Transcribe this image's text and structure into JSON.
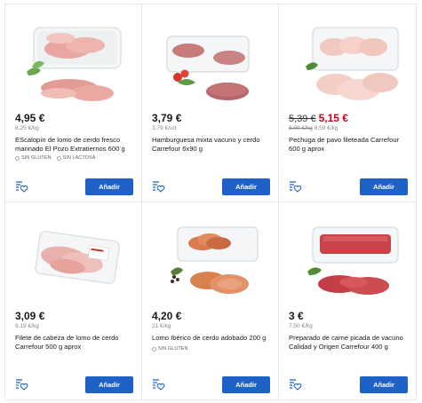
{
  "products": [
    {
      "price": "4,95 €",
      "old_price": "",
      "unit_price": "8,25 €/kg",
      "old_unit_price": "",
      "name": "EScalopín de lomo de cerdo fresco marinado El Pozo Extratiernos 600 g",
      "tags": [
        "SIN GLUTEN",
        "SIN LACTOSA"
      ],
      "image": "pork-loin-escalope-tray",
      "button": "Añadir"
    },
    {
      "price": "3,79 €",
      "old_price": "",
      "unit_price": "3,79 €/ud",
      "old_unit_price": "",
      "name": "Hamburguesa mixta vacuno y cerdo Carrefour 6x90 g",
      "tags": [],
      "image": "burger-patties-tray",
      "button": "Añadir"
    },
    {
      "price": "5,15 €",
      "old_price": "5,39 €",
      "unit_price": "8,59 €/kg",
      "old_unit_price": "8,99 €/kg",
      "name": "Pechuga de pavo fileteada Carrefour 600 g aprox",
      "tags": [],
      "image": "turkey-breast-fillets-tray",
      "button": "Añadir"
    },
    {
      "price": "3,09 €",
      "old_price": "",
      "unit_price": "6,19 €/kg",
      "old_unit_price": "",
      "name": "Filete de cabeza de lomo de cerdo Carrefour 500 g aprox",
      "tags": [],
      "image": "pork-neck-fillet-tray",
      "button": "Añadir"
    },
    {
      "price": "4,20 €",
      "old_price": "",
      "unit_price": "21 €/kg",
      "old_unit_price": "",
      "name": "Lomo Ibérico de cerdo adobado 200 g",
      "tags": [
        "SIN GLUTEN"
      ],
      "image": "marinated-iberian-loin-tray",
      "button": "Añadir"
    },
    {
      "price": "3 €",
      "old_price": "",
      "unit_price": "7,50 €/kg",
      "old_unit_price": "",
      "name": "Preparado de carne picada de vacuno Calidad y Origen Carrefour 400 g",
      "tags": [],
      "image": "minced-beef-tray",
      "button": "Añadir"
    }
  ],
  "colors": {
    "button_bg": "#1e62c8",
    "sale_price": "#d6001c",
    "border": "#e6e6e6",
    "fav_icon": "#1e62c8"
  },
  "icons": {
    "favourite": "list-heart-icon",
    "tag": "circle-tag-icon"
  }
}
